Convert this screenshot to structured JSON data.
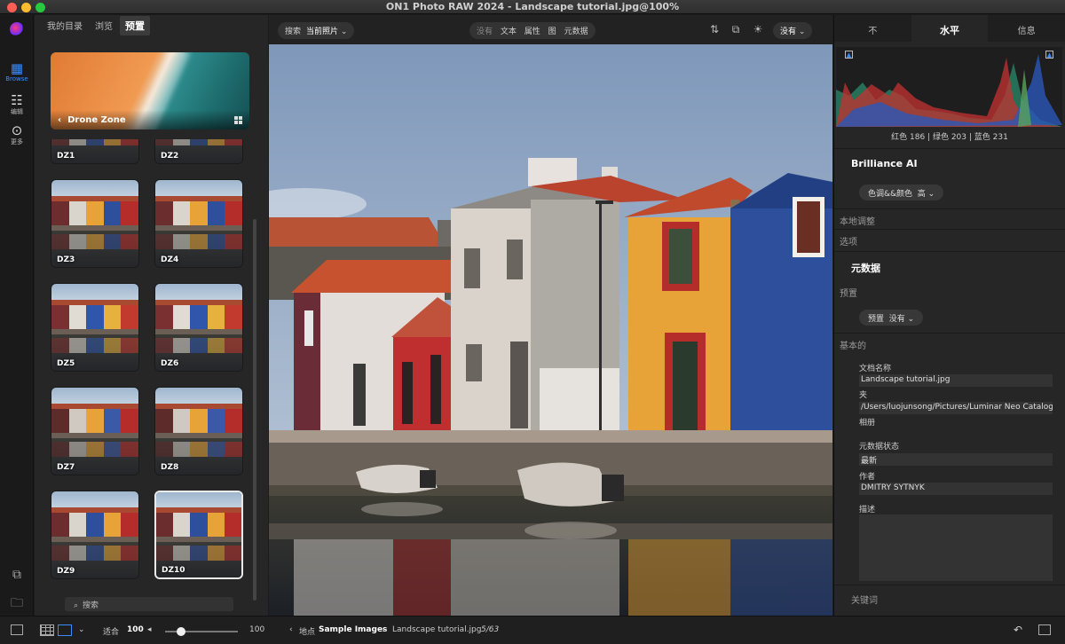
{
  "window": {
    "title": "ON1 Photo RAW 2024 - Landscape tutorial.jpg@100%"
  },
  "rail": {
    "items": [
      {
        "label": "Browse",
        "icon": "browse-icon"
      },
      {
        "label": "编辑",
        "icon": "sliders-icon"
      },
      {
        "label": "更多",
        "icon": "more-icon"
      }
    ]
  },
  "left_panel": {
    "tabs": [
      "我的目录",
      "浏览",
      "预置"
    ],
    "active_tab": "预置",
    "category": "Drone Zone",
    "presets": [
      "DZ1",
      "DZ2",
      "DZ3",
      "DZ4",
      "DZ5",
      "DZ6",
      "DZ7",
      "DZ8",
      "DZ9",
      "DZ10"
    ],
    "selected_preset": "DZ10",
    "search_placeholder": "搜索"
  },
  "toolbar": {
    "search_label": "搜索",
    "search_scope": "当前照片",
    "overlay_options": [
      "没有",
      "文本",
      "属性",
      "图",
      "元数据"
    ],
    "compare_value": "没有"
  },
  "right_panel": {
    "tabs": [
      "不",
      "水平",
      "信息"
    ],
    "active_tab": "水平",
    "histogram_readout": "红色 186 | 绿色 203 | 蓝色 231",
    "brilliance_title": "Brilliance AI",
    "brilliance_option": "色调&&颜色",
    "brilliance_value": "高",
    "local_adjust": "本地调整",
    "options": "选项",
    "metadata_title": "元数据",
    "preset_section": "预置",
    "preset_label": "预置",
    "preset_value": "没有",
    "basic_section": "基本的",
    "fields": {
      "filename_label": "文档名称",
      "filename_value": "Landscape tutorial.jpg",
      "folder_label": "夹",
      "folder_value": "/Users/luojunsong/Pictures/Luminar Neo Catalog/Sa",
      "album_label": "相册",
      "status_label": "元数据状态",
      "status_value": "最新",
      "author_label": "作者",
      "author_value": "DMITRY SYTNYK",
      "desc_label": "描述"
    },
    "keywords": "关键词"
  },
  "status_bar": {
    "fit_label": "适合",
    "zoom_value": "100",
    "zoom_max": "100",
    "location_label": "地点",
    "location_value": "Sample Images",
    "filename": "Landscape tutorial.jpg",
    "count": "5/63"
  },
  "colors": {
    "accent": "#3b8cff",
    "panel": "#262626",
    "house_red": "#b8282a",
    "house_yellow": "#e8a83a",
    "house_blue": "#2d4f9c"
  }
}
